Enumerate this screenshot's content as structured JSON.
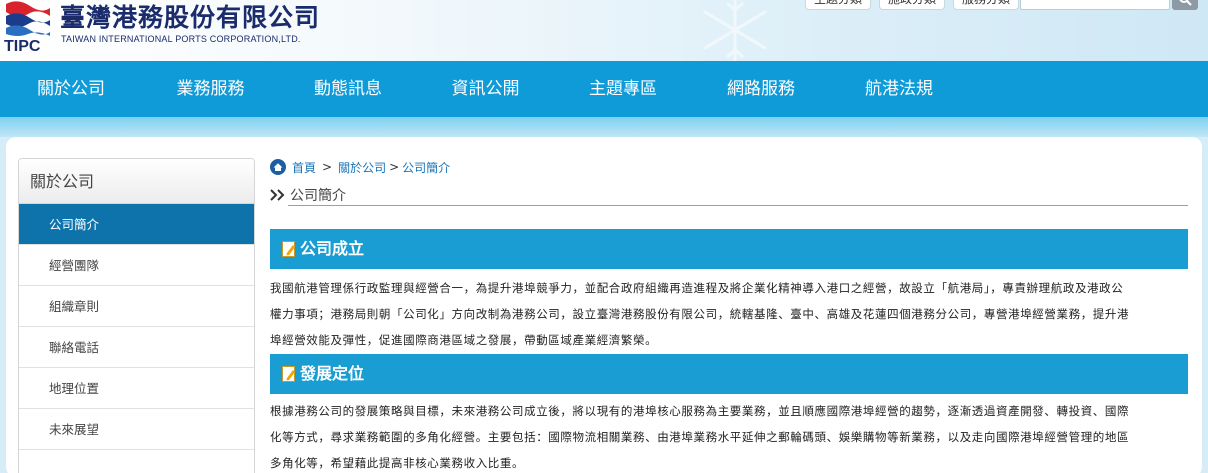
{
  "header": {
    "logo_mark_text": "TIPC",
    "company_name": "臺灣港務股份有限公司",
    "company_name_en": "TAIWAN INTERNATIONAL PORTS CORPORATION,LTD.",
    "top_links": [
      "主題分類",
      "施政分類",
      "服務分類"
    ]
  },
  "nav": {
    "items": [
      "關於公司",
      "業務服務",
      "動態訊息",
      "資訊公開",
      "主題專區",
      "網路服務",
      "航港法規"
    ]
  },
  "sidebar": {
    "title": "關於公司",
    "items": [
      "公司簡介",
      "經營團隊",
      "組織章則",
      "聯絡電話",
      "地理位置",
      "未來展望"
    ],
    "active_index": 0
  },
  "breadcrumb": {
    "home": "首頁",
    "sep": ">",
    "level1": "關於公司",
    "level2": "公司簡介"
  },
  "page": {
    "title": "公司簡介"
  },
  "sections": [
    {
      "heading": "公司成立",
      "lines": [
        "我國航港管理係行政監理與經營合一，為提升港埠競爭力，並配合政府組織再造進程及將企業化精神導入港口之經營，故設立「航港局」，專責辦理航政及港政公",
        "權力事項；港務局則朝「公司化」方向改制為港務公司，設立臺灣港務股份有限公司，統轄基隆、臺中、高雄及花蓮四個港務分公司，專營港埠經營業務，提升港",
        "埠經營效能及彈性，促進國際商港區域之發展，帶動區域產業經濟繁榮。"
      ]
    },
    {
      "heading": "發展定位",
      "lines": [
        "根據港務公司的發展策略與目標，未來港務公司成立後，將以現有的港埠核心服務為主要業務，並且順應國際港埠經營的趨勢，逐漸透過資產開發、轉投資、國際",
        "化等方式，尋求業務範圍的多角化經營。主要包括：國際物流相關業務、由港埠業務水平延伸之郵輪碼頭、娛樂購物等新業務，以及走向國際港埠經營管理的地區",
        "多角化等，希望藉此提高非核心業務收入比重。"
      ]
    }
  ],
  "colors": {
    "nav_bg": "#0f9ad8",
    "section_bar": "#1a9dd2",
    "sidebar_active": "#0e73ab",
    "brand_navy": "#1a2c6b"
  }
}
